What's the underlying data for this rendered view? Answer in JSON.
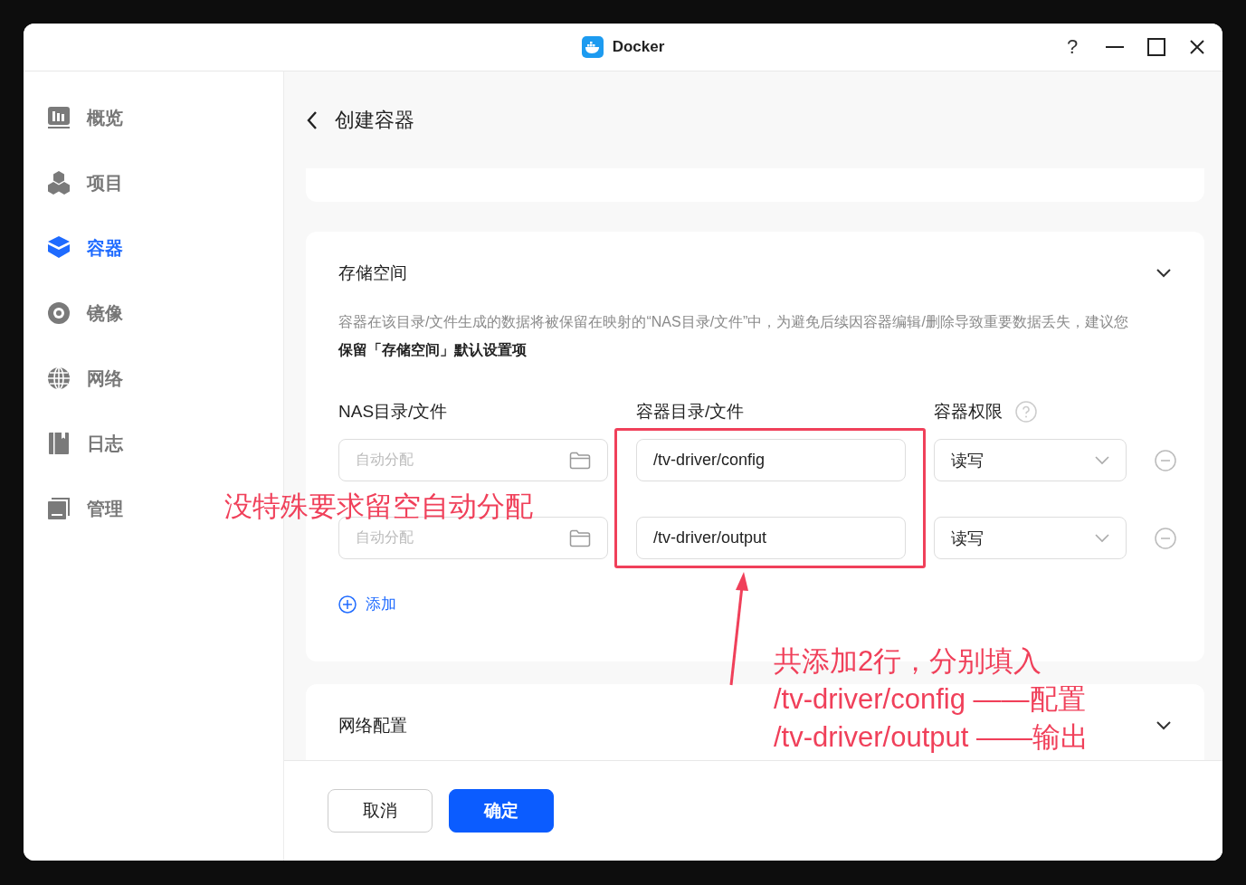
{
  "window": {
    "title": "Docker",
    "help": "?"
  },
  "sidebar": {
    "items": [
      {
        "label": "概览",
        "selected": false
      },
      {
        "label": "项目",
        "selected": false
      },
      {
        "label": "容器",
        "selected": true
      },
      {
        "label": "镜像",
        "selected": false
      },
      {
        "label": "网络",
        "selected": false
      },
      {
        "label": "日志",
        "selected": false
      },
      {
        "label": "管理",
        "selected": false
      }
    ]
  },
  "page": {
    "title": "创建容器"
  },
  "storage": {
    "title": "存储空间",
    "description": "容器在该目录/文件生成的数据将被保留在映射的“NAS目录/文件”中，为避免后续因容器编辑/删除导致重要数据丢失，建议您**保留「存储空间」默认设置项**",
    "columns": [
      "NAS目录/文件",
      "容器目录/文件",
      "容器权限"
    ],
    "rows": [
      {
        "nas_placeholder": "自动分配",
        "container_path": "/tv-driver/config",
        "permission": "读写"
      },
      {
        "nas_placeholder": "自动分配",
        "container_path": "/tv-driver/output",
        "permission": "读写"
      }
    ],
    "add_label": "添加"
  },
  "network": {
    "title": "网络配置"
  },
  "buttons": {
    "cancel": "取消",
    "confirm": "确定"
  },
  "annotations": {
    "left_note": "没特殊要求留空自动分配",
    "right_note": [
      "共添加2行，分别填入",
      "/tv-driver/config ——配置",
      "/tv-driver/output ——输出"
    ]
  }
}
